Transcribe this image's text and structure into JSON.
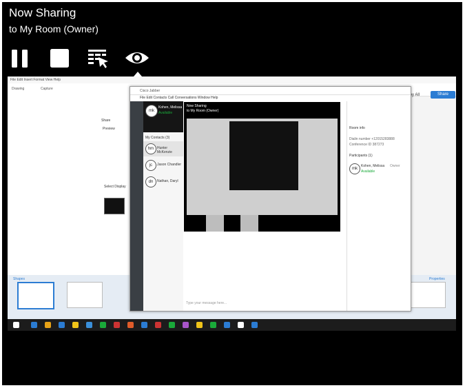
{
  "header": {
    "title": "Now Sharing",
    "subtitle": "to My Room (Owner)"
  },
  "controls": [
    {
      "name": "pause-icon",
      "label": "Pause"
    },
    {
      "name": "stop-icon",
      "label": "Stop"
    },
    {
      "name": "annotate-icon",
      "label": "Control"
    },
    {
      "name": "eye-icon",
      "label": "Preview",
      "active": true
    }
  ],
  "colors": {
    "background": "#000000",
    "text": "#ffffff",
    "accent": "#2b7cd3",
    "online": "#1aaa3a"
  },
  "preview": {
    "menubar": "File  Edit  Insert  Format  View  Help",
    "toolbar_items": [
      "Drawing",
      "Capture"
    ],
    "copy_all": "Copy All",
    "share_btn": "Share",
    "canvas_label_1": "Share",
    "canvas_label_2": "Preview",
    "canvas_label_3": "Select Display",
    "bottom_left": "Shapes",
    "bottom_right": "Properties",
    "window": {
      "title": "Cisco Jabber",
      "menu": "File  Edit  Contacts  Call  Conversations  Window  Help",
      "user_name": "Kohen, Melissa",
      "user_status": "Available",
      "user_initials": "mk",
      "section": "My Contacts (3)",
      "contacts": [
        {
          "initials": "hm",
          "name": "Hunter McKenzie"
        },
        {
          "initials": "jc",
          "name": "Jason Chandler"
        },
        {
          "initials": "dn",
          "name": "Nathan, Daryl"
        }
      ],
      "sharing_title": "Now Sharing",
      "sharing_subtitle": "to My Room (Owner)",
      "room_info_label": "Room info",
      "dialin": "Dialin number +12015283888",
      "conference": "Conference ID 387273",
      "participants_label": "Participants (1)",
      "participant_name": "Kohen, Melissa",
      "participant_role": "Owner",
      "participant_status": "Available",
      "chat_placeholder": "Type your message here..."
    }
  }
}
